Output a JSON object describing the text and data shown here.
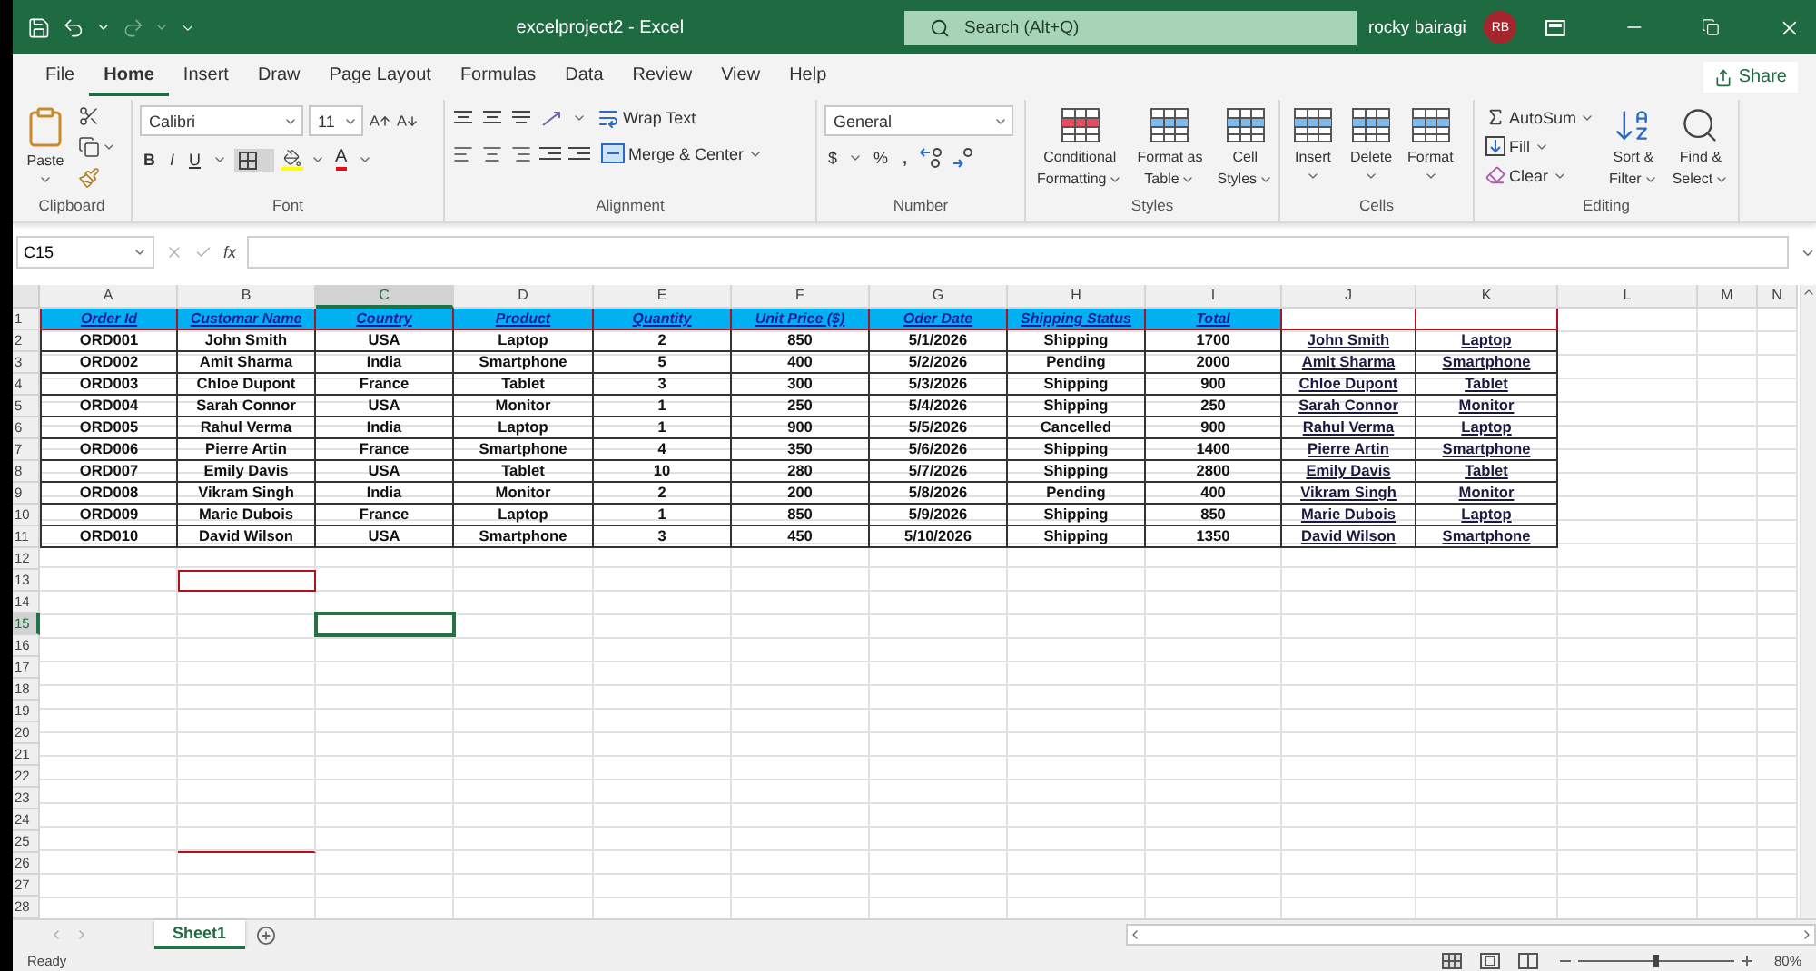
{
  "window": {
    "title": "excelproject2  -  Excel",
    "search_placeholder": "Search (Alt+Q)",
    "user": "rocky bairagi",
    "avatar": "RB"
  },
  "menu_tabs": [
    {
      "label": "File",
      "selected": false
    },
    {
      "label": "Home",
      "selected": true
    },
    {
      "label": "Insert",
      "selected": false
    },
    {
      "label": "Draw",
      "selected": false
    },
    {
      "label": "Page Layout",
      "selected": false
    },
    {
      "label": "Formulas",
      "selected": false
    },
    {
      "label": "Data",
      "selected": false
    },
    {
      "label": "Review",
      "selected": false
    },
    {
      "label": "View",
      "selected": false
    },
    {
      "label": "Help",
      "selected": false
    }
  ],
  "share": "Share",
  "ribbon": {
    "clipboard": {
      "paste": "Paste",
      "label": "Clipboard"
    },
    "font": {
      "font_name": "Calibri",
      "font_size": "11",
      "bold": "B",
      "italic": "I",
      "underline": "U",
      "font_color": "A",
      "label": "Font"
    },
    "alignment": {
      "wrap_text": "Wrap Text",
      "merge_center": "Merge & Center",
      "label": "Alignment"
    },
    "number": {
      "format": "General",
      "currency": "$",
      "percent": "%",
      "comma": ",",
      "label": "Number"
    },
    "styles": {
      "buttons": [
        {
          "line1": "Conditional",
          "line2": "Formatting"
        },
        {
          "line1": "Format as",
          "line2": "Table"
        },
        {
          "line1": "Cell",
          "line2": "Styles"
        }
      ],
      "label": "Styles"
    },
    "cells": {
      "buttons": [
        "Insert",
        "Delete",
        "Format"
      ],
      "label": "Cells"
    },
    "editing": {
      "autosum": "AutoSum",
      "fill": "Fill",
      "clear": "Clear",
      "sort": {
        "line1": "Sort &",
        "line2": "Filter"
      },
      "find": {
        "line1": "Find &",
        "line2": "Select"
      },
      "label": "Editing"
    }
  },
  "formula_bar": {
    "name_box": "C15",
    "fx": "fx"
  },
  "columns": [
    {
      "label": "A",
      "selected": false
    },
    {
      "label": "B",
      "selected": false
    },
    {
      "label": "C",
      "selected": true
    },
    {
      "label": "D",
      "selected": false
    },
    {
      "label": "E",
      "selected": false
    },
    {
      "label": "F",
      "selected": false
    },
    {
      "label": "G",
      "selected": false
    },
    {
      "label": "H",
      "selected": false
    },
    {
      "label": "I",
      "selected": false
    },
    {
      "label": "J",
      "selected": false
    },
    {
      "label": "K",
      "selected": false
    },
    {
      "label": "L",
      "selected": false
    },
    {
      "label": "M",
      "selected": false
    },
    {
      "label": "N",
      "selected": false
    }
  ],
  "row_numbers": [
    {
      "label": "1",
      "selected": false
    },
    {
      "label": "2",
      "selected": false
    },
    {
      "label": "3",
      "selected": false
    },
    {
      "label": "4",
      "selected": false
    },
    {
      "label": "5",
      "selected": false
    },
    {
      "label": "6",
      "selected": false
    },
    {
      "label": "7",
      "selected": false
    },
    {
      "label": "8",
      "selected": false
    },
    {
      "label": "9",
      "selected": false
    },
    {
      "label": "10",
      "selected": false
    },
    {
      "label": "11",
      "selected": false
    },
    {
      "label": "12",
      "selected": false
    },
    {
      "label": "13",
      "selected": false
    },
    {
      "label": "14",
      "selected": false
    },
    {
      "label": "15",
      "selected": true
    },
    {
      "label": "16",
      "selected": false
    },
    {
      "label": "17",
      "selected": false
    },
    {
      "label": "18",
      "selected": false
    },
    {
      "label": "19",
      "selected": false
    },
    {
      "label": "20",
      "selected": false
    },
    {
      "label": "21",
      "selected": false
    },
    {
      "label": "22",
      "selected": false
    },
    {
      "label": "23",
      "selected": false
    },
    {
      "label": "24",
      "selected": false
    },
    {
      "label": "25",
      "selected": false
    },
    {
      "label": "26",
      "selected": false
    },
    {
      "label": "27",
      "selected": false
    },
    {
      "label": "28",
      "selected": false
    }
  ],
  "table_header": [
    "Order Id",
    "Customar Name",
    "Country",
    "Product",
    "Quantity",
    "Unit Price ($)",
    "Oder Date",
    "Shipping Status",
    "Total"
  ],
  "table_rows": [
    {
      "cells": [
        "ORD001",
        "John Smith",
        "USA",
        "Laptop",
        "2",
        "850",
        "5/1/2026",
        "Shipping",
        "1700"
      ],
      "lookup": [
        "John Smith",
        "Laptop"
      ]
    },
    {
      "cells": [
        "ORD002",
        "Amit Sharma",
        "India",
        "Smartphone",
        "5",
        "400",
        "5/2/2026",
        "Pending",
        "2000"
      ],
      "lookup": [
        "Amit Sharma",
        "Smartphone"
      ]
    },
    {
      "cells": [
        "ORD003",
        "Chloe Dupont",
        "France",
        "Tablet",
        "3",
        "300",
        "5/3/2026",
        "Shipping",
        "900"
      ],
      "lookup": [
        "Chloe Dupont",
        "Tablet"
      ]
    },
    {
      "cells": [
        "ORD004",
        "Sarah Connor",
        "USA",
        "Monitor",
        "1",
        "250",
        "5/4/2026",
        "Shipping",
        "250"
      ],
      "lookup": [
        "Sarah Connor",
        "Monitor"
      ]
    },
    {
      "cells": [
        "ORD005",
        "Rahul Verma",
        "India",
        "Laptop",
        "1",
        "900",
        "5/5/2026",
        "Cancelled",
        "900"
      ],
      "lookup": [
        "Rahul Verma",
        "Laptop"
      ]
    },
    {
      "cells": [
        "ORD006",
        "Pierre Artin",
        "France",
        "Smartphone",
        "4",
        "350",
        "5/6/2026",
        "Shipping",
        "1400"
      ],
      "lookup": [
        "Pierre Artin",
        "Smartphone"
      ]
    },
    {
      "cells": [
        "ORD007",
        "Emily Davis",
        "USA",
        "Tablet",
        "10",
        "280",
        "5/7/2026",
        "Shipping",
        "2800"
      ],
      "lookup": [
        "Emily Davis",
        "Tablet"
      ]
    },
    {
      "cells": [
        "ORD008",
        "Vikram Singh",
        "India",
        "Monitor",
        "2",
        "200",
        "5/8/2026",
        "Pending",
        "400"
      ],
      "lookup": [
        "Vikram Singh",
        "Monitor"
      ]
    },
    {
      "cells": [
        "ORD009",
        "Marie Dubois",
        "France",
        "Laptop",
        "1",
        "850",
        "5/9/2026",
        "Shipping",
        "850"
      ],
      "lookup": [
        "Marie Dubois",
        "Laptop"
      ]
    },
    {
      "cells": [
        "ORD010",
        "David Wilson",
        "USA",
        "Smartphone",
        "3",
        "450",
        "5/10/2026",
        "Shipping",
        "1350"
      ],
      "lookup": [
        "David Wilson",
        "Smartphone"
      ]
    }
  ],
  "sheet_tabs": [
    {
      "label": "Sheet1",
      "selected": true
    }
  ],
  "status": "Ready",
  "zoom_slider": {
    "level": 0.5
  },
  "zoom": "80%"
}
